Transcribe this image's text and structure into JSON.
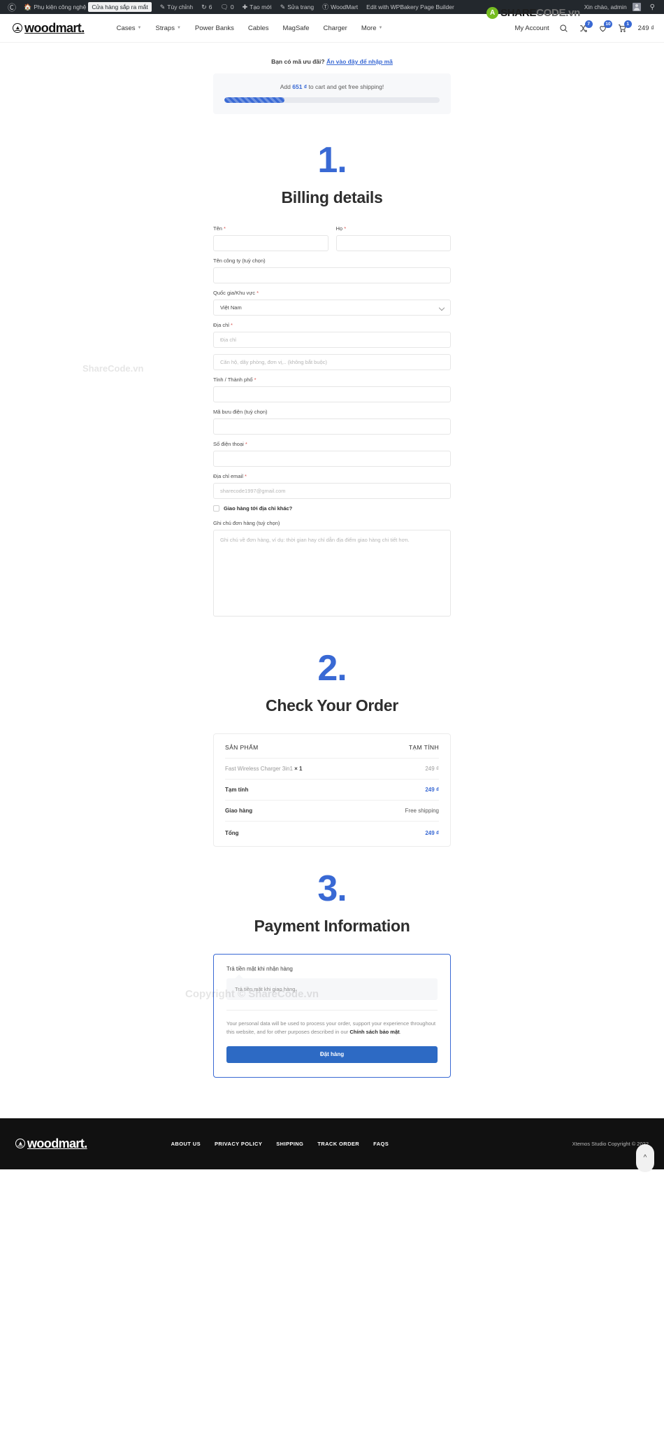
{
  "adminbar": {
    "wp_icon": "wordpress-icon",
    "site_name": "Phụ kiện công nghệ",
    "coming_soon_pill": "Cửa hàng sắp ra mắt",
    "customize": "Tùy chỉnh",
    "updates_count": "6",
    "comments_count": "0",
    "new": "Tạo mới",
    "edit_page": "Sửa trang",
    "woodmart": "WoodMart",
    "wpbakery": "Edit with WPBakery Page Builder",
    "howdy": "Xin chào, admin",
    "search_icon": "search-icon"
  },
  "watermark": {
    "badge": "A",
    "text_a": "SHARE",
    "text_b": "CODE.vn",
    "body_1": "ShareCode.vn",
    "body_2": "Copyright © ShareCode.vn"
  },
  "header": {
    "logo": "woodmart.",
    "nav": [
      {
        "label": "Cases",
        "has_caret": true
      },
      {
        "label": "Straps",
        "has_caret": true
      },
      {
        "label": "Power Banks",
        "has_caret": false
      },
      {
        "label": "Cables",
        "has_caret": false
      },
      {
        "label": "MagSafe",
        "has_caret": false
      },
      {
        "label": "Charger",
        "has_caret": false
      },
      {
        "label": "More",
        "has_caret": true
      }
    ],
    "my_account": "My Account",
    "search_icon": "search-icon",
    "compare_icon": "compare-icon",
    "compare_count": "7",
    "wishlist_icon": "heart-icon",
    "wishlist_count": "10",
    "cart_icon": "cart-icon",
    "cart_count": "1",
    "cart_total": "249 ₫"
  },
  "coupon": {
    "question": "Bạn có mã ưu đãi?",
    "link": "Ấn vào đây để nhập mã"
  },
  "free_shipping": {
    "prefix": "Add",
    "amount": "651 ₫",
    "suffix": "to cart and get free shipping!",
    "progress_percent": 28
  },
  "steps": [
    {
      "number": "1.",
      "title": "Billing details"
    },
    {
      "number": "2.",
      "title": "Check Your Order"
    },
    {
      "number": "3.",
      "title": "Payment Information"
    }
  ],
  "billing": {
    "first_name": {
      "label": "Tên",
      "required": true,
      "value": "",
      "placeholder": ""
    },
    "last_name": {
      "label": "Họ",
      "required": true,
      "value": "",
      "placeholder": ""
    },
    "company": {
      "label": "Tên công ty (tuỳ chọn)",
      "required": false,
      "value": "",
      "placeholder": ""
    },
    "country": {
      "label": "Quốc gia/Khu vực",
      "required": true,
      "value": "Việt Nam"
    },
    "address1": {
      "label": "Địa chỉ",
      "required": true,
      "value": "",
      "placeholder": "Địa chỉ"
    },
    "address2": {
      "label": "",
      "required": false,
      "value": "",
      "placeholder": "Căn hộ, dãy phòng, đơn vị,.. (không bắt buộc)"
    },
    "city": {
      "label": "Tỉnh / Thành phố",
      "required": true,
      "value": "",
      "placeholder": ""
    },
    "postcode": {
      "label": "Mã bưu điện (tuỳ chọn)",
      "required": false,
      "value": "",
      "placeholder": ""
    },
    "phone": {
      "label": "Số điện thoại",
      "required": true,
      "value": "",
      "placeholder": ""
    },
    "email": {
      "label": "Địa chỉ email",
      "required": true,
      "value": "",
      "placeholder": "sharecode1997@gmail.com"
    },
    "ship_different": "Giao hàng tới địa chỉ khác?",
    "order_notes_label": "Ghi chú đơn hàng (tuỳ chọn)",
    "order_notes_placeholder": "Ghi chú về đơn hàng, ví dụ: thời gian hay chỉ dẫn địa điểm giao hàng chi tiết hơn."
  },
  "order": {
    "head_product": "SẢN PHẨM",
    "head_subtotal": "TẠM TÍNH",
    "items": [
      {
        "name": "Fast Wireless Charger 3in1",
        "qty": "× 1",
        "price": "249 ₫"
      }
    ],
    "subtotal_label": "Tạm tính",
    "subtotal_value": "249 ₫",
    "shipping_label": "Giao hàng",
    "shipping_value": "Free shipping",
    "total_label": "Tổng",
    "total_value": "249 ₫"
  },
  "payment": {
    "method_title": "Trả tiền mặt khi nhận hàng",
    "method_desc": "Trả tiền mặt khi giao hàng.",
    "privacy_a": "Your personal data will be used to process your order, support your experience throughout this website, and for other purposes described in our ",
    "privacy_link": "Chính sách bảo mật",
    "privacy_b": ".",
    "place_order": "Đặt hàng"
  },
  "footer": {
    "logo": "woodmart.",
    "links": [
      "ABOUT US",
      "PRIVACY POLICY",
      "SHIPPING",
      "TRACK ORDER",
      "FAQS"
    ],
    "copyright": "Xtemos Studio Copyright © 2022",
    "scroll_top_icon": "chevron-up-icon"
  }
}
